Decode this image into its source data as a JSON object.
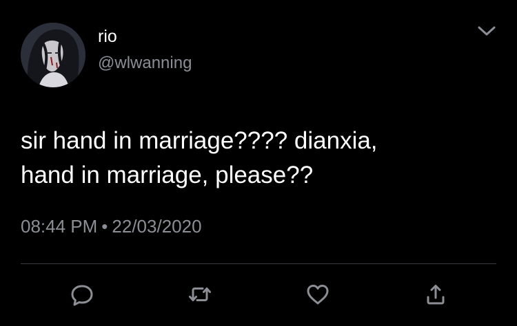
{
  "user": {
    "display_name": "rio",
    "handle": "@wlwanning"
  },
  "tweet": {
    "text_line_1": "sir hand in marriage???? dianxia,",
    "text_line_2": "hand in marriage, please??",
    "time": "08:44 PM",
    "separator": "•",
    "date": "22/03/2020"
  },
  "actions": {
    "icons": [
      "reply-icon",
      "retweet-icon",
      "like-icon",
      "share-icon"
    ]
  },
  "colors": {
    "background": "#000000",
    "primary_text": "#ffffff",
    "secondary_text": "#8b8f95",
    "icon": "#8b8f95",
    "divider": "#3a3d42"
  }
}
